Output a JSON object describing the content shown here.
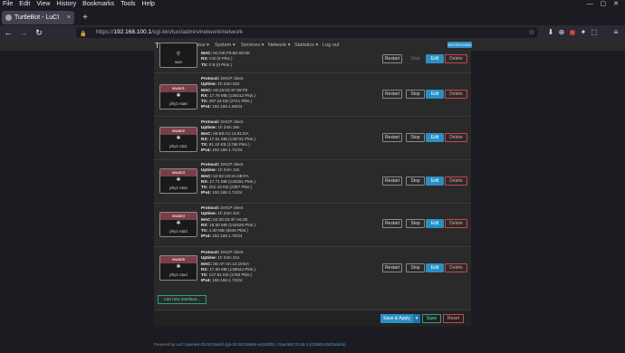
{
  "menu": [
    "File",
    "Edit",
    "View",
    "History",
    "Bookmarks",
    "Tools",
    "Help"
  ],
  "window_controls": "— ▢ ✕",
  "tab": {
    "title": "TurtleBot - LuCI",
    "close": "×"
  },
  "new_tab": "+",
  "nav_buttons": {
    "back": "←",
    "forward": "→",
    "reload": "↻"
  },
  "url": {
    "prefix": "https://",
    "host": "192.168.100.1",
    "path": "/cgi-bin/luci/admin/network/network"
  },
  "bookmark_star": "☆",
  "toolbar_icons": [
    "⬇",
    "⊕",
    "◼",
    "✦",
    "⬚",
    "≡"
  ],
  "luci": {
    "brand": "TurtleBot",
    "nav": [
      "Status ▾",
      "System ▾",
      "Services ▾",
      "Network ▾",
      "Statistics ▾",
      "Log out"
    ],
    "refreshing": "REFRESHING"
  },
  "interfaces": [
    {
      "badge": "wan",
      "icon": "⚲",
      "device": "wan",
      "partial": true,
      "lines": [
        {
          "k": "MAC:",
          "v": " 6C:DE:F9:8D:00:5E"
        },
        {
          "k": "RX:",
          "v": " 0 B (0 Pkts.)"
        },
        {
          "k": "TX:",
          "v": " 0 B (0 Pkts.)"
        }
      ],
      "stop_enabled": false
    },
    {
      "badge": "wwan1",
      "icon": "✱",
      "device": "phy1-sta0",
      "lines": [
        {
          "k": "Protocol:",
          "v": " DHCP client"
        },
        {
          "k": "Uptime:",
          "v": " 1h 34m 52s"
        },
        {
          "k": "MAC:",
          "v": " A8:16:02:1F:69:F8"
        },
        {
          "k": "RX:",
          "v": " 17.76 MB (139212 Pkts.)"
        },
        {
          "k": "TX:",
          "v": " 267.24 KB (2741 Pkts.)"
        },
        {
          "k": "IPv4:",
          "v": " 192.168.1.68/24"
        }
      ],
      "stop_enabled": true
    },
    {
      "badge": "wwan2",
      "icon": "✱",
      "device": "phy1-sta1",
      "lines": [
        {
          "k": "Protocol:",
          "v": " DHCP client"
        },
        {
          "k": "Uptime:",
          "v": " 1h 34m 28s"
        },
        {
          "k": "MAC:",
          "v": " 66:B0:A1:14:91:DA"
        },
        {
          "k": "RX:",
          "v": " 17.61 MB (138731 Pkts.)"
        },
        {
          "k": "TX:",
          "v": " 91.10 KB (1766 Pkts.)"
        },
        {
          "k": "IPv4:",
          "v": " 192.168.1.71/24"
        }
      ],
      "stop_enabled": true
    },
    {
      "badge": "wwan3",
      "icon": "✱",
      "device": "phy1-sta2",
      "lines": [
        {
          "k": "Protocol:",
          "v": " DHCP client"
        },
        {
          "k": "Uptime:",
          "v": " 1h 34m 12s"
        },
        {
          "k": "MAC:",
          "v": " 52:92:1D:2A:6B:FA"
        },
        {
          "k": "RX:",
          "v": " 17.71 MB (140261 Pkts.)"
        },
        {
          "k": "TX:",
          "v": " 291.18 KB (2387 Pkts.)"
        },
        {
          "k": "IPv4:",
          "v": " 192.168.1.74/24"
        }
      ],
      "stop_enabled": true
    },
    {
      "badge": "wwan4",
      "icon": "✱",
      "device": "phy1-sta3",
      "lines": [
        {
          "k": "Protocol:",
          "v": " DHCP client"
        },
        {
          "k": "Uptime:",
          "v": " 1h 34m 42s"
        },
        {
          "k": "MAC:",
          "v": " 62:30:20:4F:A6:2E"
        },
        {
          "k": "RX:",
          "v": " 18.50 MB (142526 Pkts.)"
        },
        {
          "k": "TX:",
          "v": " 4.30 MB (6845 Pkts.)"
        },
        {
          "k": "IPv4:",
          "v": " 192.168.1.70/24"
        }
      ],
      "stop_enabled": true
    },
    {
      "badge": "wwan5",
      "icon": "✱",
      "device": "phy1-sta4",
      "lines": [
        {
          "k": "Protocol:",
          "v": " DHCP client"
        },
        {
          "k": "Uptime:",
          "v": " 1h 34m 21s"
        },
        {
          "k": "MAC:",
          "v": " 0E:AF:4A:14:19:EA"
        },
        {
          "k": "RX:",
          "v": " 17.59 MB (138544 Pkts.)"
        },
        {
          "k": "TX:",
          "v": " 127.81 KB (1786 Pkts.)"
        },
        {
          "k": "IPv4:",
          "v": " 192.168.1.72/24"
        }
      ],
      "stop_enabled": true
    }
  ],
  "buttons": {
    "restart": "Restart",
    "stop": "Stop",
    "edit": "Edit",
    "delete": "Delete"
  },
  "add_interface": "Add new interface...",
  "actions": {
    "save_apply": "Save & Apply",
    "caret": "▾",
    "save": "Save",
    "reset": "Reset"
  },
  "footer": {
    "prefix": "Powered by ",
    "link": "LuCI openwrt-23.05 branch (git-24.342.06664-e42d33b) / OpenWrt 23.05.3 (r23809-234f1a2efa)"
  },
  "colors": {
    "edit": "#2a8fc2",
    "delete": "#c5484b",
    "save": "#2aa27d",
    "badge_header": "#7a3f45"
  }
}
